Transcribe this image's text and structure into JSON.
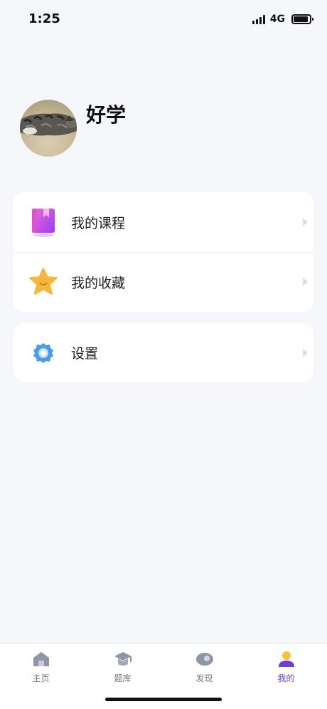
{
  "status_bar": {
    "time": "1:25",
    "network": "4G"
  },
  "profile": {
    "name": "好学"
  },
  "menu": {
    "items": [
      {
        "label": "我的课程",
        "icon": "course-book-icon"
      },
      {
        "label": "我的收藏",
        "icon": "star-icon"
      }
    ],
    "settings": {
      "label": "设置",
      "icon": "gear-icon"
    }
  },
  "tab_bar": {
    "tabs": [
      {
        "label": "主页",
        "icon": "home-icon"
      },
      {
        "label": "题库",
        "icon": "graduation-cap-icon"
      },
      {
        "label": "发现",
        "icon": "discover-icon"
      },
      {
        "label": "我的",
        "icon": "user-icon"
      }
    ],
    "active_tab": "我的"
  },
  "colors": {
    "accent": "#6b3fd6",
    "background": "#f6f7fb",
    "card": "#ffffff"
  }
}
